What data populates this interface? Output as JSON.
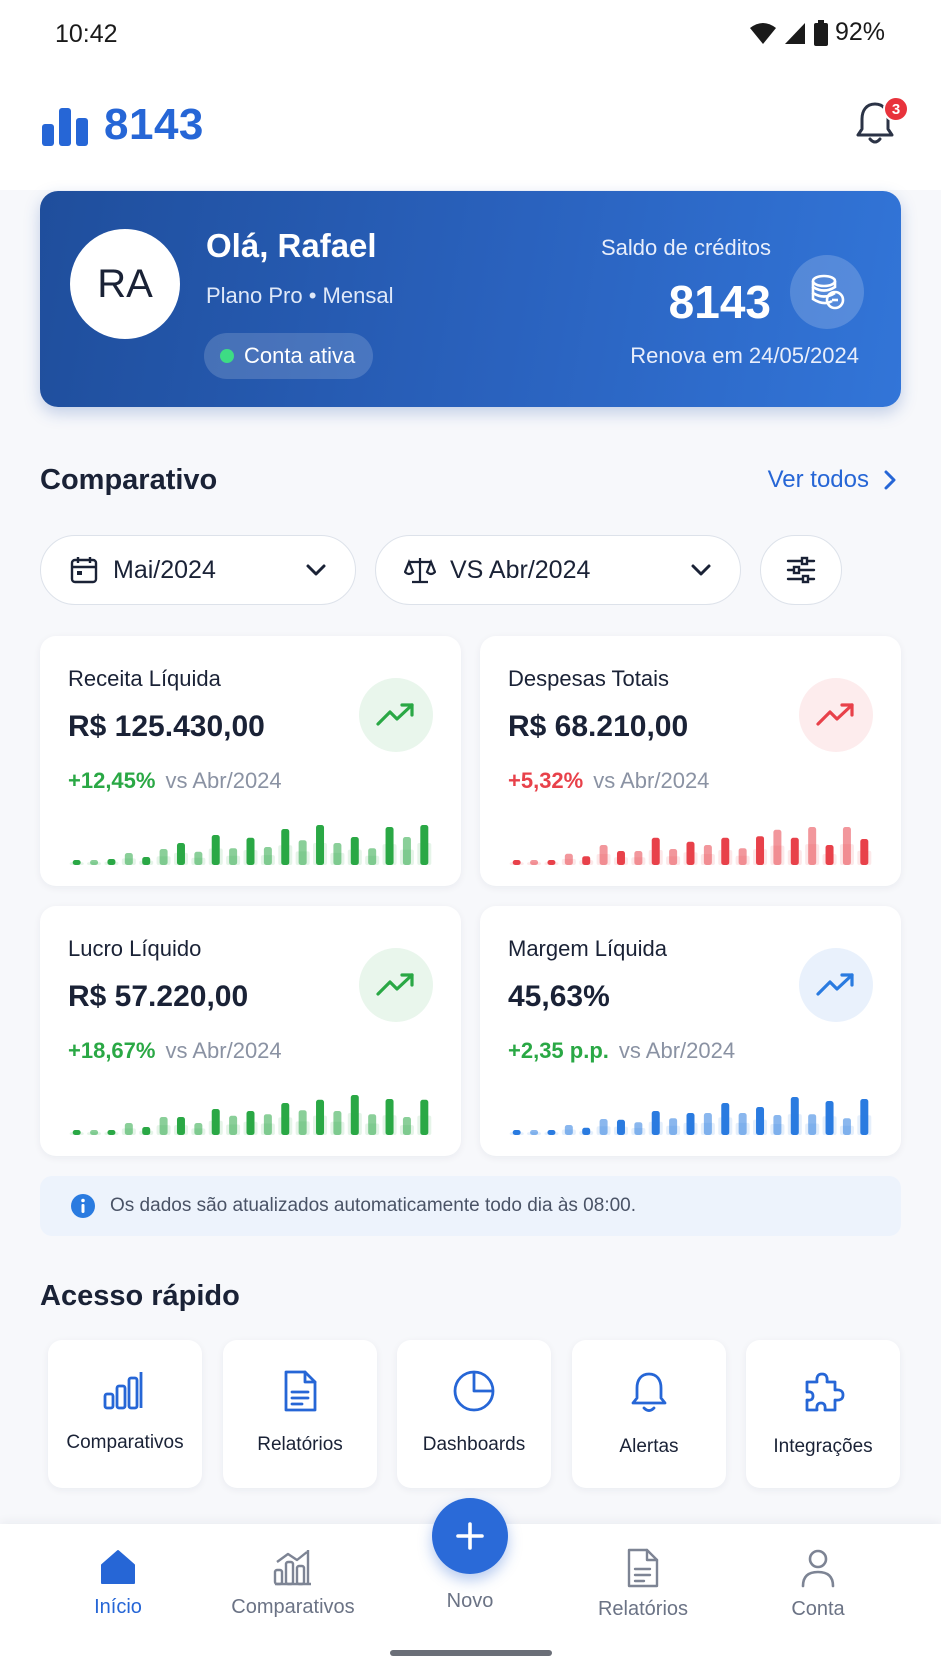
{
  "status_bar": {
    "time": "10:42",
    "battery": "92%"
  },
  "header": {
    "logo_text": "8143",
    "notification_count": "3"
  },
  "hero": {
    "avatar_initials": "RA",
    "greeting": "Olá, Rafael",
    "plan": "Plano Pro • Mensal",
    "status": "Conta ativa",
    "credits_label": "Saldo de créditos",
    "credits_value": "8143",
    "renew": "Renova em 24/05/2024"
  },
  "comparativo": {
    "title": "Comparativo",
    "see_all": "Ver todos",
    "period_filter": "Mai/2024",
    "compare_filter": "VS Abr/2024"
  },
  "metrics": [
    {
      "label": "Receita Líquida",
      "value": "R$ 125.430,00",
      "delta": "+12,45%",
      "vs": "vs Abr/2024",
      "color": "#2aa845",
      "bg": "#e9f6ec",
      "bars": [
        0.08,
        0.09,
        0.15,
        0.3,
        0.2,
        0.4,
        0.55,
        0.33,
        0.75,
        0.42,
        0.68,
        0.45,
        0.9,
        0.62,
        1.0,
        0.55,
        0.7,
        0.42,
        0.95,
        0.7,
        1.0
      ]
    },
    {
      "label": "Despesas Totais",
      "value": "R$ 68.210,00",
      "delta": "+5,32%",
      "vs": "vs Abr/2024",
      "color": "#e8414a",
      "bg": "#fdeced",
      "bars": [
        0.08,
        0.09,
        0.12,
        0.28,
        0.22,
        0.5,
        0.35,
        0.35,
        0.68,
        0.4,
        0.58,
        0.5,
        0.68,
        0.42,
        0.72,
        0.88,
        0.68,
        0.95,
        0.5,
        0.95,
        0.65
      ]
    },
    {
      "label": "Lucro Líquido",
      "value": "R$ 57.220,00",
      "delta": "+18,67%",
      "vs": "vs Abr/2024",
      "color": "#2aa845",
      "bg": "#e9f6ec",
      "bars": [
        0.08,
        0.09,
        0.12,
        0.3,
        0.2,
        0.45,
        0.45,
        0.3,
        0.65,
        0.48,
        0.6,
        0.52,
        0.8,
        0.62,
        0.88,
        0.6,
        1.0,
        0.52,
        0.9,
        0.45,
        0.88
      ]
    },
    {
      "label": "Margem Líquida",
      "value": "45,63%",
      "delta": "+2,35 p.p.",
      "vs": "vs Abr/2024",
      "color": "#2a7be0",
      "bg": "#e9f1fc",
      "bars": [
        0.08,
        0.09,
        0.12,
        0.25,
        0.18,
        0.4,
        0.38,
        0.32,
        0.6,
        0.42,
        0.55,
        0.55,
        0.8,
        0.55,
        0.7,
        0.5,
        0.95,
        0.52,
        0.85,
        0.42,
        0.9
      ]
    }
  ],
  "info_text": "Os dados são atualizados automaticamente todo dia às 08:00.",
  "quick_access": {
    "title": "Acesso rápido",
    "items": [
      "Comparativos",
      "Relatórios",
      "Dashboards",
      "Alertas",
      "Integrações"
    ]
  },
  "bottom_nav": {
    "home": "Início",
    "compare": "Comparativos",
    "new": "Novo",
    "reports": "Relatórios",
    "account": "Conta"
  }
}
